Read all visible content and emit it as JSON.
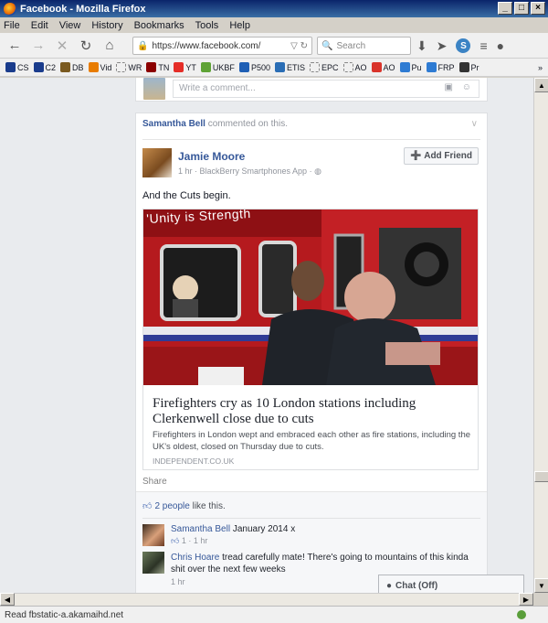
{
  "window": {
    "title": "Facebook - Mozilla Firefox",
    "controls": [
      "_",
      "□",
      "×"
    ]
  },
  "menu": [
    "File",
    "Edit",
    "View",
    "History",
    "Bookmarks",
    "Tools",
    "Help"
  ],
  "navbar": {
    "url": "https://www.facebook.com/",
    "search_placeholder": "Search"
  },
  "bookmarks": [
    {
      "label": "CS",
      "color": "#1a3c8c"
    },
    {
      "label": "C2",
      "color": "#1a3c8c"
    },
    {
      "label": "DB",
      "color": "#7a5a20"
    },
    {
      "label": "Vid",
      "color": "#e87c00"
    },
    {
      "label": "WR",
      "color": "dashed"
    },
    {
      "label": "TN",
      "color": "#8b0000"
    },
    {
      "label": "YT",
      "color": "#e52d27"
    },
    {
      "label": "UKBF",
      "color": "#5fa336"
    },
    {
      "label": "P500",
      "color": "#1f5fb5"
    },
    {
      "label": "ETIS",
      "color": "#2a6db5"
    },
    {
      "label": "EPC",
      "color": "dashed"
    },
    {
      "label": "AO",
      "color": "dashed"
    },
    {
      "label": "AO",
      "color": "#d9342b"
    },
    {
      "label": "Pu",
      "color": "#2e7bd3"
    },
    {
      "label": "FRP",
      "color": "#2e7bd3"
    },
    {
      "label": "Pr",
      "color": "#333333"
    }
  ],
  "comment_box": {
    "placeholder": "Write a comment..."
  },
  "post": {
    "activity_user": "Samantha Bell",
    "activity_text": " commented on this.",
    "author": "Jamie Moore",
    "meta": "1 hr · BlackBerry Smartphones App · ",
    "add_friend_label": "Add Friend",
    "status": "And the Cuts begin.",
    "photo_banner": "'Unity is Strength",
    "link_title": "Firefighters cry as 10 London stations including Clerkenwell close due to cuts",
    "link_desc": "Firefighters in London wept and embraced each other as fire stations, including the UK's oldest, closed on Thursday due to cuts.",
    "link_domain": "INDEPENDENT.CO.UK",
    "share_label": "Share",
    "likes_count": "2 people",
    "likes_text": " like this."
  },
  "comments": [
    {
      "name": "Samantha Bell",
      "text": " January 2014 x",
      "meta": "1 · 1 hr"
    },
    {
      "name": "Chris Hoare",
      "text": " tread carefully mate! There's going to mountains of this kinda shit over the next few weeks",
      "meta": "1 hr"
    }
  ],
  "chat_label": "Chat (Off)",
  "status_text": "Read fbstatic-a.akamaihd.net"
}
